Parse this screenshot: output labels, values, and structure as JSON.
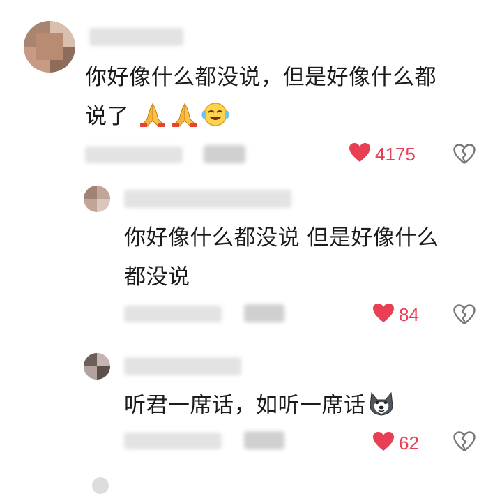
{
  "comments": [
    {
      "text_line1": "你好像什么都没说，但是好像什么都",
      "text_line2": "说了",
      "likes": "4175",
      "emoji": [
        "pray-hands",
        "pray-hands",
        "laugh-cry-face"
      ]
    },
    {
      "text_line1": "你好像什么都没说 但是好像什么",
      "text_line2": "都没说",
      "likes": "84"
    },
    {
      "text_line1": "听君一席话，如听一席话",
      "likes": "62",
      "emoji": [
        "husky-dog-face"
      ]
    }
  ],
  "colors": {
    "like": "#e83f55",
    "dislike": "#777777"
  },
  "icons": {
    "like": "heart-icon",
    "dislike": "broken-heart-icon"
  }
}
